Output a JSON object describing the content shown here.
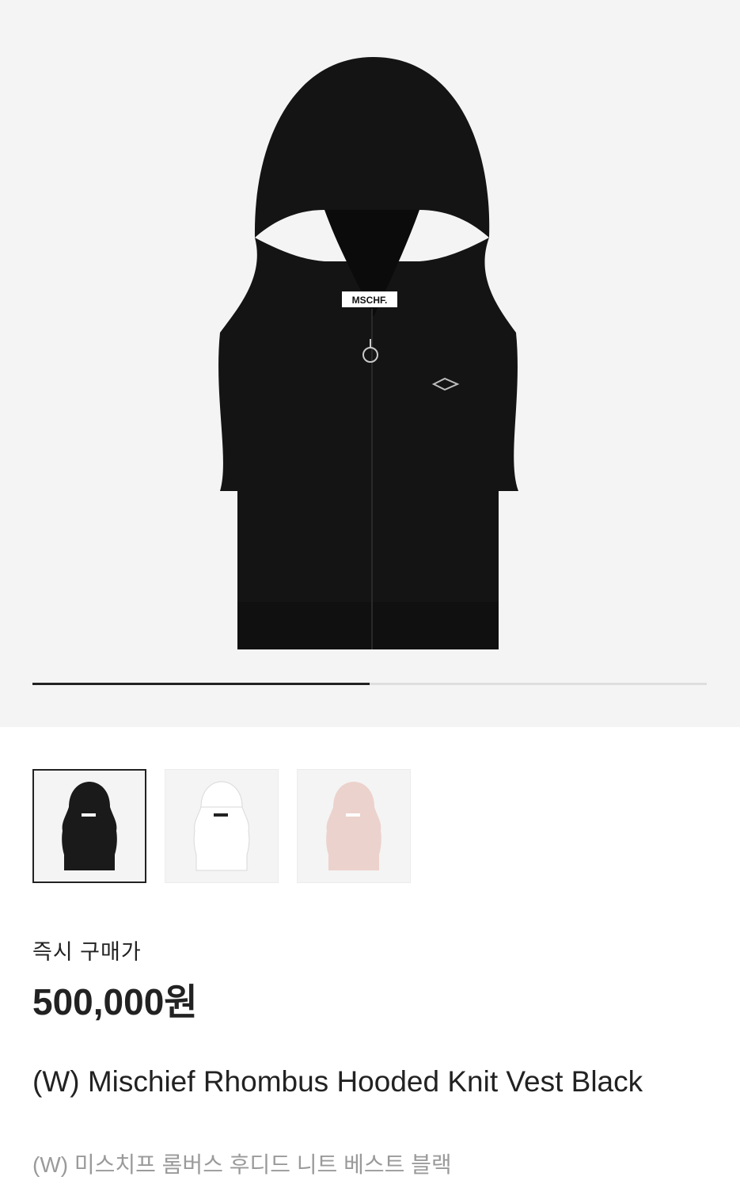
{
  "hero": {
    "image": "black-hooded-knit-vest-image",
    "brand_tag": "MSCHF.",
    "slide_progress": 0.5
  },
  "thumbnails": [
    {
      "color": "#1a1a1a",
      "name": "black-vest-thumbnail",
      "selected": true
    },
    {
      "color": "#f2f2f2",
      "name": "white-vest-thumbnail",
      "selected": false
    },
    {
      "color": "#ecd2cc",
      "name": "pink-vest-thumbnail",
      "selected": false
    }
  ],
  "pricing": {
    "label": "즉시 구매가",
    "price": "500,000원"
  },
  "product": {
    "title": "(W) Mischief Rhombus Hooded Knit Vest Black",
    "title_ko": "(W) 미스치프 롬버스 후디드 니트 베스트 블랙"
  },
  "colors": {
    "hero_bg": "#f4f4f4",
    "text": "#222222",
    "muted": "#9a9a9a"
  }
}
